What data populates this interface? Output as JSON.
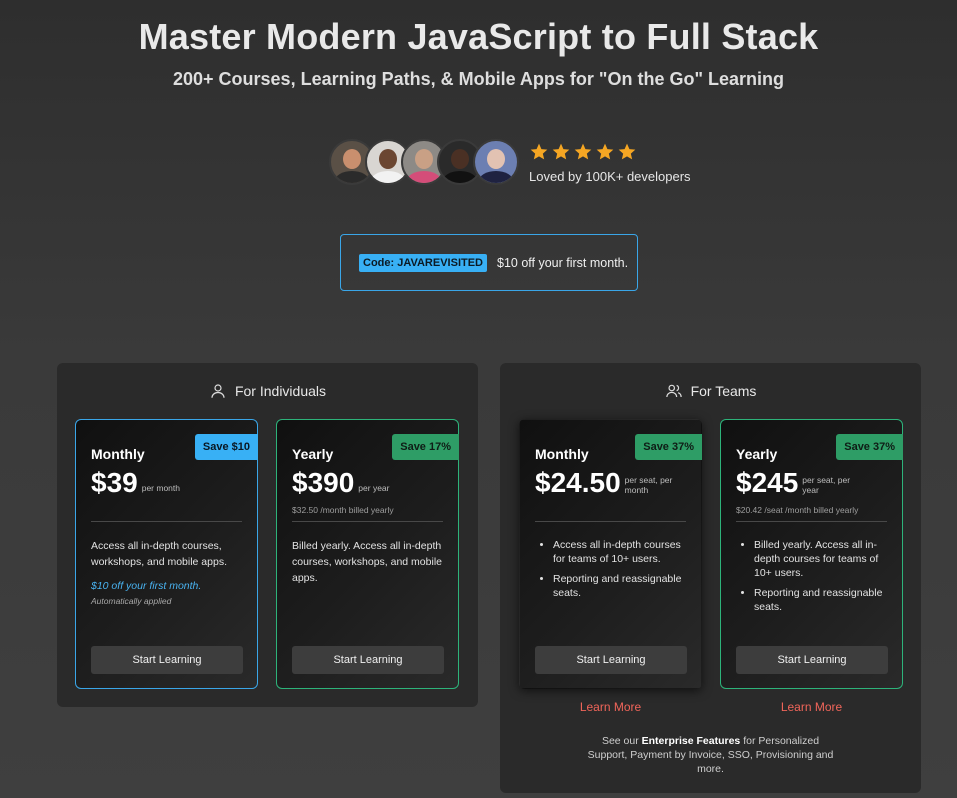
{
  "hero": {
    "title": "Master Modern JavaScript to Full Stack",
    "subtitle": "200+ Courses, Learning Paths, & Mobile Apps for \"On the Go\" Learning"
  },
  "social_proof": {
    "rating": 5,
    "rating_max": 5,
    "star_color": "#f5a623",
    "text": "Loved by 100K+ developers",
    "avatars": [
      "developer-avatar-1",
      "developer-avatar-2",
      "developer-avatar-3",
      "developer-avatar-4",
      "developer-avatar-5"
    ]
  },
  "promo": {
    "code_label": "Code: JAVAREVISITED",
    "text": "$10 off your first month."
  },
  "individuals": {
    "heading": "For Individuals",
    "icon": "user-icon",
    "plans": [
      {
        "name": "Monthly",
        "price": "$39",
        "unit": "per month",
        "subnote": "",
        "badge": "Save $10",
        "description": "Access all in-depth courses, workshops, and mobile apps.",
        "offer": "$10 off your first month.",
        "offer_note": "Automatically applied",
        "cta": "Start Learning"
      },
      {
        "name": "Yearly",
        "price": "$390",
        "unit": "per year",
        "subnote": "$32.50 /month billed yearly",
        "badge": "Save 17%",
        "description": "Billed yearly. Access all in-depth courses, workshops, and mobile apps.",
        "cta": "Start Learning"
      }
    ]
  },
  "teams": {
    "heading": "For Teams",
    "icon": "users-icon",
    "plans": [
      {
        "name": "Monthly",
        "price": "$24.50",
        "unit": "per seat, per month",
        "subnote": "",
        "badge": "Save 37%",
        "bullets": [
          "Access all in-depth courses for teams of 10+ users.",
          "Reporting and reassignable seats."
        ],
        "cta": "Start Learning",
        "learn_more": "Learn More"
      },
      {
        "name": "Yearly",
        "price": "$245",
        "unit": "per seat, per year",
        "subnote": "$20.42 /seat /month billed yearly",
        "badge": "Save 37%",
        "bullets": [
          "Billed yearly. Access all in-depth courses for teams of 10+ users.",
          "Reporting and reassignable seats."
        ],
        "cta": "Start Learning",
        "learn_more": "Learn More"
      }
    ],
    "enterprise_prefix": "See our",
    "enterprise_link": "Enterprise Features",
    "enterprise_suffix": "for Personalized Support, Payment by Invoice, SSO, Provisioning and more."
  },
  "colors": {
    "accent_blue": "#38b0f5",
    "accent_green": "#2e9d66",
    "link_red": "#f0655a"
  }
}
